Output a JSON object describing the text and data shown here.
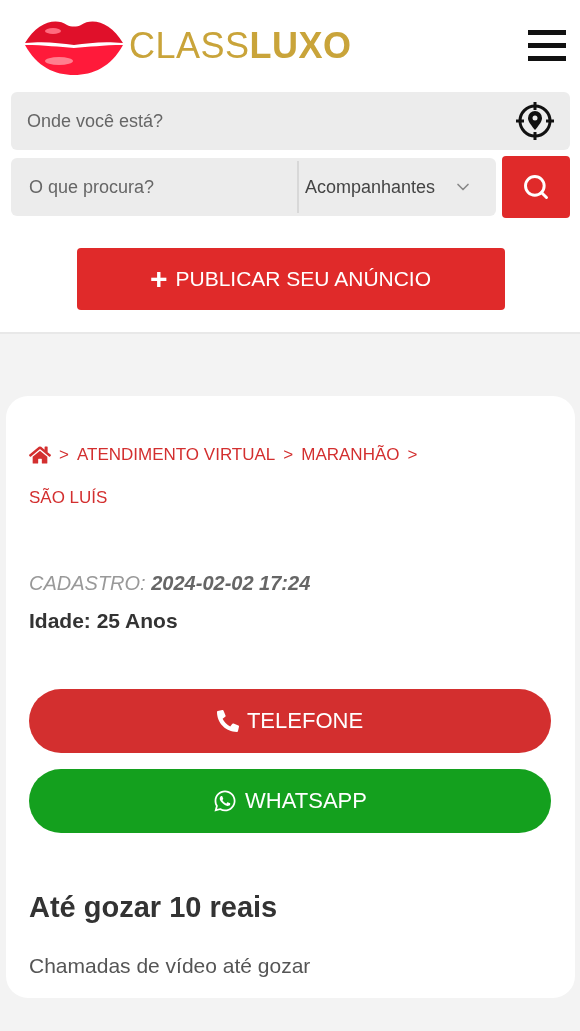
{
  "header": {
    "logo": {
      "part_1": "CLASS",
      "part_2": "LUXO"
    }
  },
  "search": {
    "location_placeholder": "Onde você está?",
    "query_placeholder": "O que procura?",
    "category": "Acompanhantes"
  },
  "publish_button": {
    "icon": "+",
    "label": "PUBLICAR SEU ANÚNCIO"
  },
  "breadcrumb": [
    {
      "separator": ">",
      "label": "ATENDIMENTO VIRTUAL"
    },
    {
      "separator": ">",
      "label": "MARANHÃO"
    },
    {
      "separator": ">",
      "label": "SÃO LUÍS"
    }
  ],
  "listing": {
    "registered_label": "CADASTRO:",
    "registered_value": "2024-02-02 17:24",
    "age": "Idade: 25 Anos",
    "buttons": [
      {
        "kind": "phone",
        "label": "TELEFONE"
      },
      {
        "kind": "whatsapp",
        "label": "WHATSAPP"
      }
    ],
    "title": "Até gozar 10 reais",
    "description": "Chamadas de vídeo até gozar"
  }
}
